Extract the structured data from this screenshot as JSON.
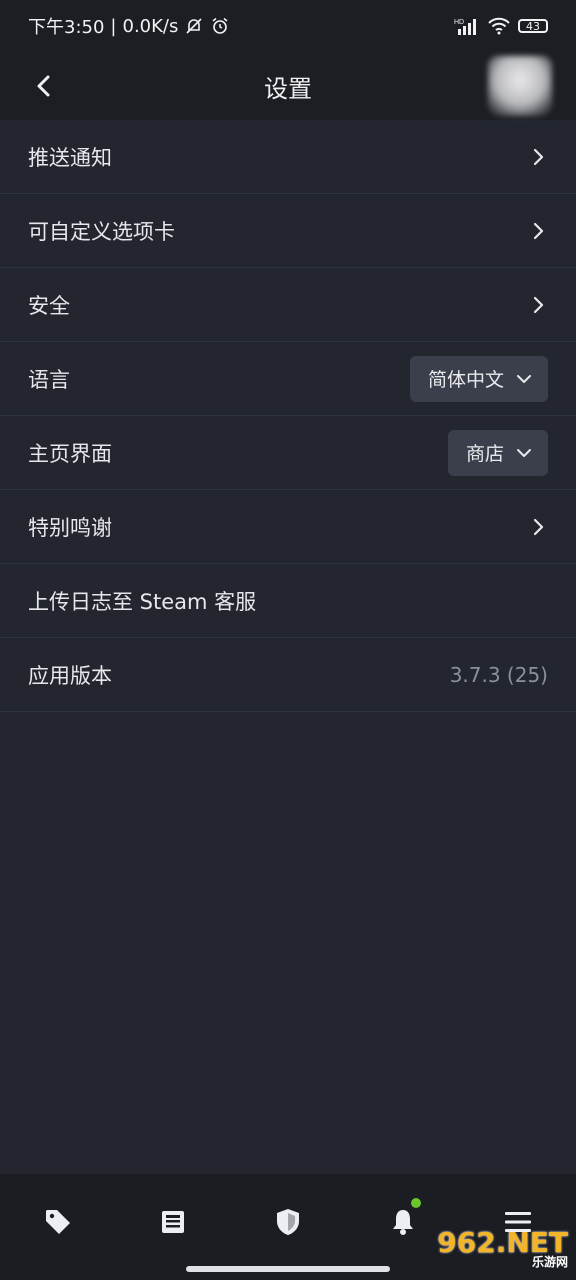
{
  "status_bar": {
    "time": "下午3:50",
    "speed": "0.0K/s",
    "battery": "43",
    "hd_label": "HD"
  },
  "header": {
    "title": "设置"
  },
  "settings": {
    "push_notifications": "推送通知",
    "custom_tabs": "可自定义选项卡",
    "security": "安全",
    "language": "语言",
    "language_value": "简体中文",
    "home_screen": "主页界面",
    "home_screen_value": "商店",
    "special_thanks": "特别鸣谢",
    "upload_logs": "上传日志至 Steam 客服",
    "app_version": "应用版本",
    "app_version_value": "3.7.3 (25)"
  },
  "watermark": {
    "brand": "962.NET",
    "sub": "乐游网"
  },
  "colors": {
    "background": "#23262e",
    "header": "#1c1e24",
    "badge": "#6bc62a"
  },
  "icons": {
    "tab_store": "tag-icon",
    "tab_news": "news-icon",
    "tab_guard": "shield-icon",
    "tab_notifications": "bell-icon",
    "tab_menu": "menu-icon"
  }
}
